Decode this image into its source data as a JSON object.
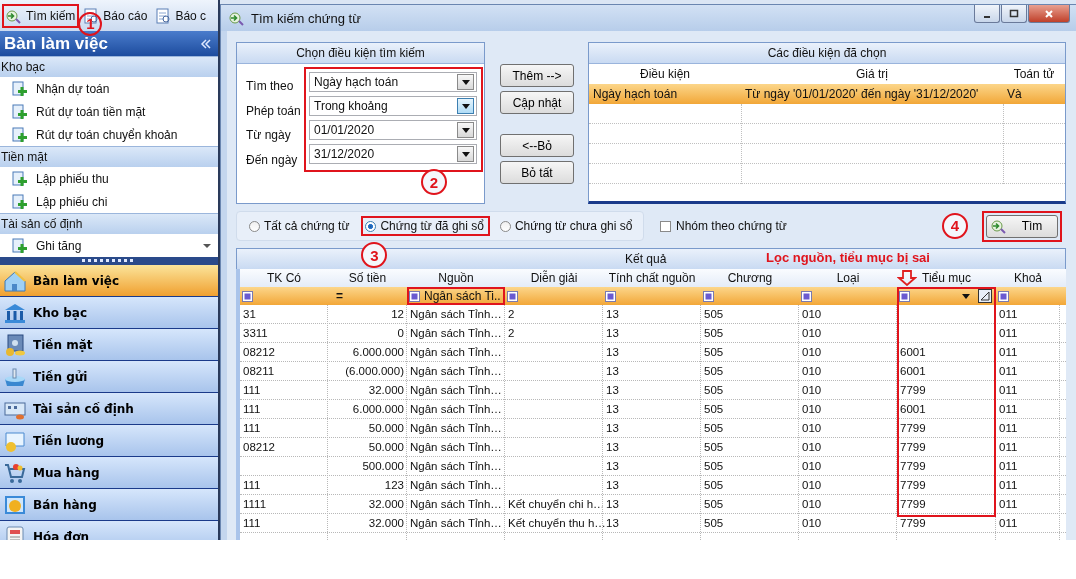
{
  "toolbar": [
    {
      "label": "Tìm kiếm",
      "highlighted": true,
      "marker": "1"
    },
    {
      "label": "Báo cáo",
      "highlighted": false
    },
    {
      "label": "Báo c",
      "highlighted": false
    }
  ],
  "sidebar": {
    "title": "Bàn làm việc",
    "groups": [
      {
        "label": "Kho bạc",
        "items": [
          "Nhận dự toán",
          "Rút dự toán tiền mặt",
          "Rút dự toán chuyển khoản"
        ]
      },
      {
        "label": "Tiền mặt",
        "items": [
          "Lập phiếu thu",
          "Lập phiếu chi"
        ]
      },
      {
        "label": "Tài sản cố định",
        "items": [
          "Ghi tăng"
        ]
      }
    ],
    "nav": [
      {
        "label": "Bàn làm việc",
        "selected": true
      },
      {
        "label": "Kho bạc",
        "selected": false
      },
      {
        "label": "Tiền mặt",
        "selected": false
      },
      {
        "label": "Tiền gửi",
        "selected": false
      },
      {
        "label": "Tài sản cố định",
        "selected": false
      },
      {
        "label": "Tiền lương",
        "selected": false
      },
      {
        "label": "Mua hàng",
        "selected": false
      },
      {
        "label": "Bán hàng",
        "selected": false
      },
      {
        "label": "Hóa đơn",
        "selected": false
      }
    ]
  },
  "dialog": {
    "title": "Tìm kiếm chứng từ",
    "criteria": {
      "title": "Chọn điều kiện tìm kiếm",
      "highlighted": true,
      "marker": "2",
      "fields": [
        {
          "label": "Tìm theo",
          "value": "Ngày hạch toán",
          "focused": false
        },
        {
          "label": "Phép toán",
          "value": "Trong khoảng",
          "focused": true
        },
        {
          "label": "Từ ngày",
          "value": "01/01/2020",
          "focused": false
        },
        {
          "label": "Đến ngày",
          "value": "31/12/2020",
          "focused": false
        }
      ]
    },
    "buttons": [
      "Thêm -->",
      "Cập nhật",
      "<--Bỏ",
      "Bỏ tất"
    ],
    "chosen": {
      "title": "Các điều kiện đã chọn",
      "columns": [
        "Điều kiện",
        "Giá trị",
        "Toán tử"
      ],
      "rows": [
        {
          "cells": [
            "Ngày hạch toán",
            "Từ ngày '01/01/2020' đến ngày '31/12/2020'",
            "Và"
          ],
          "selected": true
        }
      ]
    },
    "filters": [
      {
        "label": "Tất cả chứng từ",
        "selected": false,
        "highlighted": false
      },
      {
        "label": "Chứng từ đã ghi sổ",
        "selected": true,
        "highlighted": true,
        "marker": "3"
      },
      {
        "label": "Chứng từ chưa ghi sổ",
        "selected": false,
        "highlighted": false
      }
    ],
    "group_by": {
      "label": "Nhóm theo chứng từ",
      "checked": false
    },
    "search_button": {
      "label": "Tìm",
      "highlighted": true,
      "marker": "4"
    },
    "results": {
      "title": "Kết quả",
      "note": "Lọc nguồn, tiểu mục bị sai",
      "columns": [
        {
          "label": "TK Có",
          "filter": {
            "kind": "icon"
          },
          "highlighted": false
        },
        {
          "label": "Số tiền",
          "filter": {
            "kind": "operator",
            "text": "="
          },
          "highlighted": false
        },
        {
          "label": "Nguồn",
          "filter": {
            "kind": "value",
            "text": "Ngân sách Ti..",
            "highlighted": true
          },
          "highlighted": false
        },
        {
          "label": "Diễn giải",
          "filter": {
            "kind": "icon"
          },
          "highlighted": false
        },
        {
          "label": "Tính chất nguồn",
          "filter": {
            "kind": "icon"
          },
          "highlighted": false
        },
        {
          "label": "Chương",
          "filter": {
            "kind": "icon"
          },
          "highlighted": false
        },
        {
          "label": "Loại",
          "filter": {
            "kind": "icon"
          },
          "highlighted": false
        },
        {
          "label": "Tiểu mục",
          "filter": {
            "kind": "dropdown"
          },
          "highlighted": true
        },
        {
          "label": "Khoả",
          "filter": {
            "kind": "icon"
          },
          "highlighted": false
        }
      ],
      "rows": [
        [
          "31",
          "12",
          "Ngân sách Tỉnh…",
          "2",
          "13",
          "505",
          "010",
          "",
          "011"
        ],
        [
          "3311",
          "0",
          "Ngân sách Tỉnh…",
          "2",
          "13",
          "505",
          "010",
          "",
          "011"
        ],
        [
          "08212",
          "6.000.000",
          "Ngân sách Tỉnh…",
          "",
          "13",
          "505",
          "010",
          "6001",
          "011"
        ],
        [
          "08211",
          "(6.000.000)",
          "Ngân sách Tỉnh…",
          "",
          "13",
          "505",
          "010",
          "6001",
          "011"
        ],
        [
          "111",
          "32.000",
          "Ngân sách Tỉnh…",
          "",
          "13",
          "505",
          "010",
          "7799",
          "011"
        ],
        [
          "111",
          "6.000.000",
          "Ngân sách Tỉnh…",
          "",
          "13",
          "505",
          "010",
          "6001",
          "011"
        ],
        [
          "111",
          "50.000",
          "Ngân sách Tỉnh…",
          "",
          "13",
          "505",
          "010",
          "7799",
          "011"
        ],
        [
          "08212",
          "50.000",
          "Ngân sách Tỉnh…",
          "",
          "13",
          "505",
          "010",
          "7799",
          "011"
        ],
        [
          "",
          "500.000",
          "Ngân sách Tỉnh…",
          "",
          "13",
          "505",
          "010",
          "7799",
          "011"
        ],
        [
          "111",
          "123",
          "Ngân sách Tỉnh…",
          "",
          "13",
          "505",
          "010",
          "7799",
          "011"
        ],
        [
          "1111",
          "32.000",
          "Ngân sách Tỉnh…",
          "Kết chuyển chi h…",
          "13",
          "505",
          "010",
          "7799",
          "011"
        ],
        [
          "111",
          "32.000",
          "Ngân sách Tỉnh…",
          "Kết chuyển thu h…",
          "13",
          "505",
          "010",
          "7799",
          "011"
        ]
      ]
    }
  }
}
